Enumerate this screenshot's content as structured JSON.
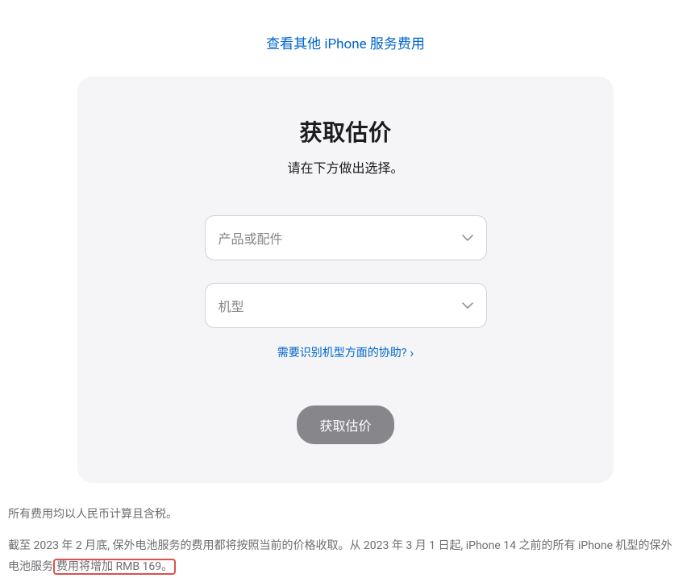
{
  "topLink": {
    "text": "查看其他 iPhone 服务费用"
  },
  "card": {
    "title": "获取估价",
    "subtitle": "请在下方做出选择。",
    "select1": {
      "placeholder": "产品或配件"
    },
    "select2": {
      "placeholder": "机型"
    },
    "helpLink": "需要识别机型方面的协助?",
    "submit": "获取估价"
  },
  "footer": {
    "line1": "所有费用均以人民币计算且含税。",
    "line2_p1": "截至 2023 年 2 月底, 保外电池服务的费用都将按照当前的价格收取。从 2023 年 3 月 1 日起, iPhone 14 之前的所有 iPhone 机型的保外电池服务",
    "line2_highlight": "费用将增加 RMB 169。"
  }
}
